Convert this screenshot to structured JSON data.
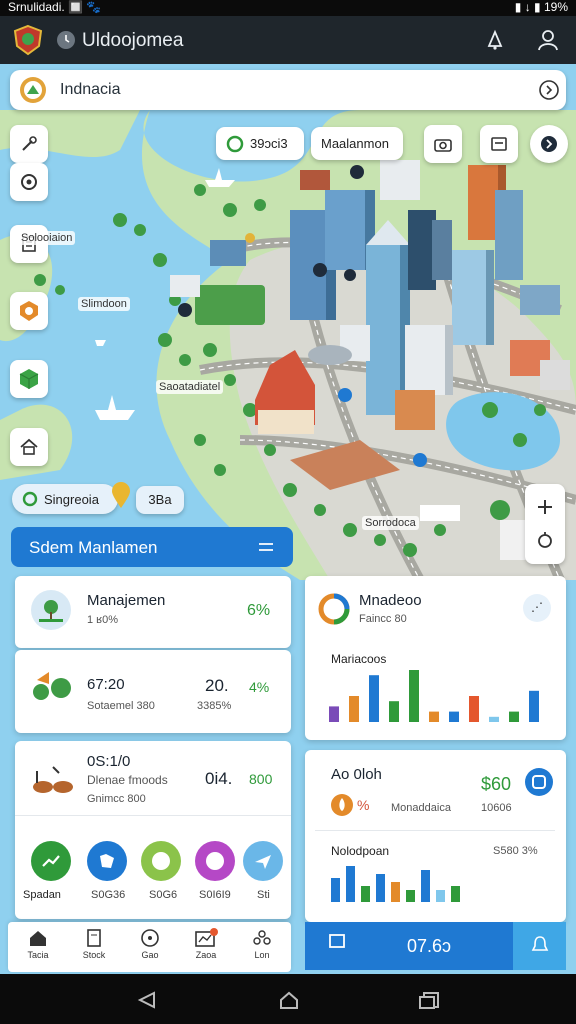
{
  "status_bar": {
    "left": "Srnulidadi. 🔲 🐾",
    "right": "▮ ↓ ▮ 19%"
  },
  "app_bar": {
    "title": "Uldoojomea"
  },
  "search": {
    "value": "Indnacia"
  },
  "map": {
    "top_chips": [
      {
        "label": "39ɔci3"
      },
      {
        "label": "Maalanmon"
      }
    ],
    "labels": [
      "Solooiaion",
      "Slimdoon",
      "Saoatadiatel",
      "Sorrodoca"
    ],
    "location_chip": {
      "label": "Singreoia",
      "badge": "3Ba"
    }
  },
  "banner": {
    "label": "Sdem Manlamen"
  },
  "cards": {
    "mgmt": {
      "title": "Manajemen",
      "sub": "1 ʁ0%",
      "value": "6%"
    },
    "stat1": {
      "title": "67:20",
      "sub": "Sotaemel 380",
      "value_a": "20.",
      "value_b": "4%",
      "sub_b": "3385%"
    },
    "stat2": {
      "title": "0S:1/0",
      "line2": "Dlenae fmoods",
      "line3": "Gnimcc 800",
      "value_a": "0i4.",
      "value_b": "800"
    },
    "monitor": {
      "title": "Mnadeoo",
      "sub": "Faincc 80",
      "chart_label": "Mariacoos"
    },
    "report": {
      "title": "Ao 0loh",
      "pct": "%",
      "sub": "Monaddaica",
      "value": "$60",
      "sub2": "10606",
      "chart_label": "Nolodpoan",
      "chart_value": "S580 3%"
    }
  },
  "icon_row": [
    {
      "label": "Spadan"
    },
    {
      "label": "S0G36"
    },
    {
      "label": "S0G6"
    },
    {
      "label": "S0I6I9"
    },
    {
      "label": "Sti"
    }
  ],
  "bottom_nav": [
    {
      "label": "Tacia"
    },
    {
      "label": "Stock"
    },
    {
      "label": "Gao"
    },
    {
      "label": "Zaoa"
    },
    {
      "label": "Lon"
    }
  ],
  "action_bar": {
    "value": "07.6ɔ"
  },
  "colors": {
    "accent_blue": "#1f79d2",
    "green": "#2f9a3a",
    "water": "#8fd0ef",
    "land": "#c7e3b0"
  },
  "chart_data": [
    {
      "type": "bar",
      "title": "Mariacoos",
      "series": [
        {
          "values": [
            3,
            5,
            9,
            4,
            10,
            2,
            2,
            5,
            1,
            2,
            6
          ]
        }
      ]
    },
    {
      "type": "bar",
      "title": "Nolodpoan",
      "series": [
        {
          "values": [
            6,
            9,
            4,
            7,
            5,
            3,
            8,
            3,
            4
          ]
        }
      ]
    }
  ]
}
